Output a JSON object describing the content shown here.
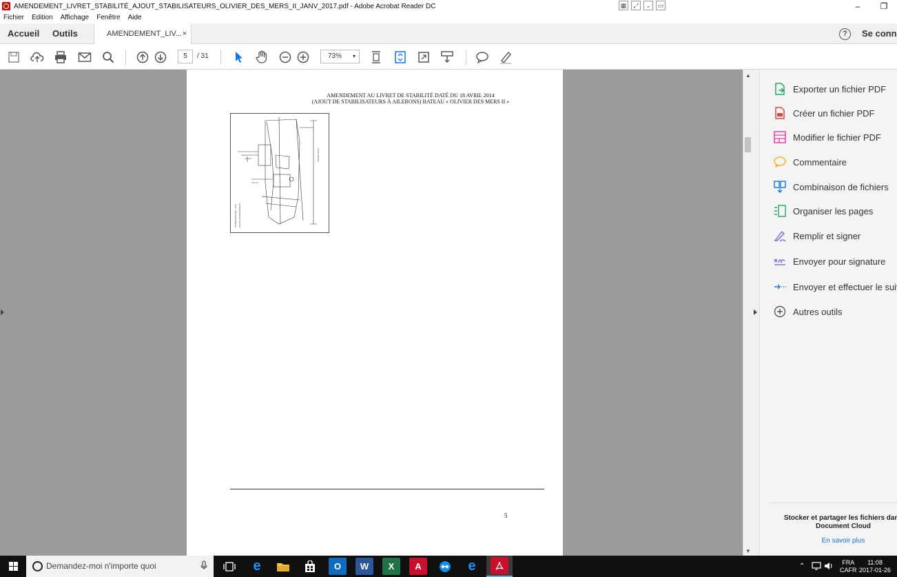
{
  "window": {
    "title": "AMENDEMENT_LIVRET_STABILITÉ_AJOUT_STABILISATEURS_OLIVIER_DES_MERS_II_JANV_2017.pdf - Adobe Acrobat Reader DC",
    "minimize": "–",
    "restore": "❐"
  },
  "menu": [
    "Fichier",
    "Edition",
    "Affichage",
    "Fenêtre",
    "Aide"
  ],
  "tabs": {
    "home": "Accueil",
    "tools": "Outils",
    "document": "AMENDEMENT_LIV...",
    "close": "×",
    "help": "?",
    "signin": "Se connecter"
  },
  "toolbar": {
    "page_current": "5",
    "page_total": "/ 31",
    "zoom": "73%",
    "zoom_caret": "▾"
  },
  "document": {
    "header_line1": "AMENDEMENT AU LIVRET DE STABILITÉ DATÉ DU 18 AVRIL 2014",
    "header_line2": "(AJOUT DE STABILISATEURS À AILERONS) BATEAU « OLIVIER DES MERS II »",
    "page_number": "5"
  },
  "right_pane": {
    "items": [
      {
        "label": "Exporter un fichier PDF",
        "icon": "export-pdf-icon",
        "color": "#26a56b"
      },
      {
        "label": "Créer un fichier PDF",
        "icon": "create-pdf-icon",
        "color": "#e0443e"
      },
      {
        "label": "Modifier le fichier PDF",
        "icon": "edit-pdf-icon",
        "color": "#e040a0"
      },
      {
        "label": "Commentaire",
        "icon": "comment-icon",
        "color": "#f0b429"
      },
      {
        "label": "Combinaison de fichiers",
        "icon": "combine-files-icon",
        "color": "#1473e6"
      },
      {
        "label": "Organiser les pages",
        "icon": "organize-pages-icon",
        "color": "#26a56b"
      },
      {
        "label": "Remplir et signer",
        "icon": "fill-sign-icon",
        "color": "#7b5fd6"
      },
      {
        "label": "Envoyer pour signature",
        "icon": "send-signature-icon",
        "color": "#7b5fd6"
      },
      {
        "label": "Envoyer et effectuer le suivi",
        "icon": "send-track-icon",
        "color": "#1473e6"
      },
      {
        "label": "Autres outils",
        "icon": "more-tools-icon",
        "color": "#555555"
      }
    ],
    "cloud_line1": "Stocker et partager les fichiers dans",
    "cloud_line2": "Document Cloud",
    "learn_more": "En savoir plus"
  },
  "taskbar": {
    "search_placeholder": "Demandez-moi n'importe quoi",
    "lang1": "FRA",
    "lang2": "CAFR",
    "time": "11:08",
    "date": "2017-01-26"
  }
}
